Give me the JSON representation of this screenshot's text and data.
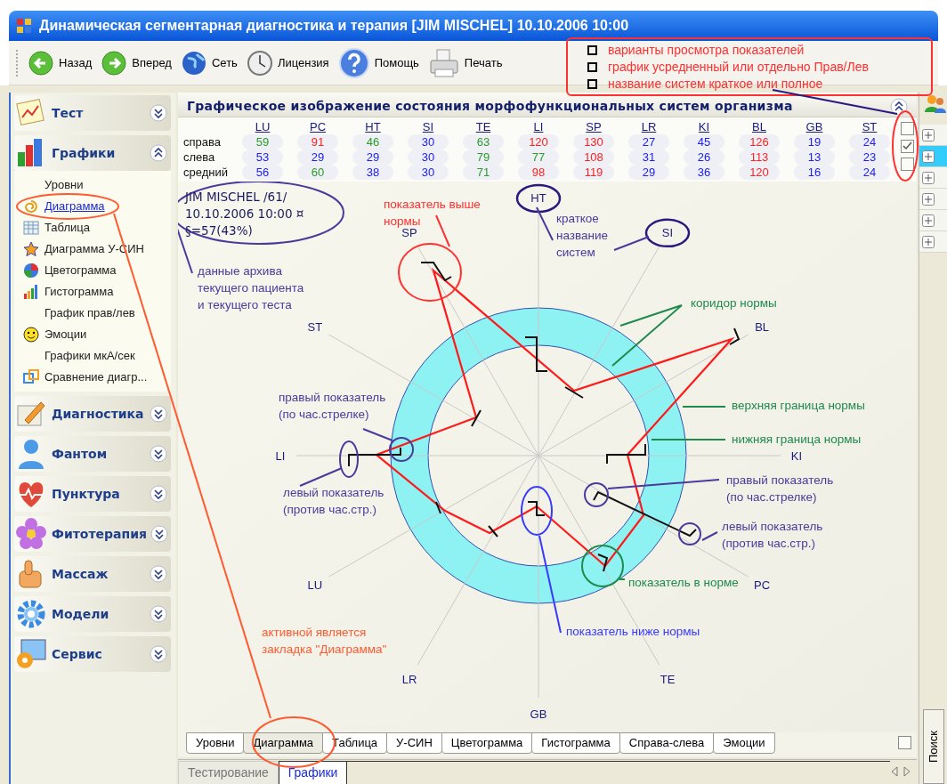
{
  "window": {
    "title": "Динамическая сегментарная диагностика и терапия [JIM MISCHEL] 10.10.2006 10:00"
  },
  "toolbar": [
    {
      "label": "Назад",
      "kind": "back"
    },
    {
      "label": "Вперед",
      "kind": "forward"
    },
    {
      "label": "Сеть",
      "kind": "globe"
    },
    {
      "label": "Лицензия",
      "kind": "clock"
    },
    {
      "label": "Помощь",
      "kind": "help"
    },
    {
      "label": "Печать",
      "kind": "printer"
    }
  ],
  "legend": [
    "варианты просмотра показателей",
    "график усредненный или отдельно Прав/Лев",
    "название систем краткое или полное"
  ],
  "sidebar": [
    {
      "label": "Тест",
      "kind": "test",
      "expanded": false
    },
    {
      "label": "Графики",
      "kind": "charts",
      "expanded": true,
      "items": [
        {
          "label": "Уровни",
          "selected": false
        },
        {
          "label": "Диаграмма",
          "selected": true
        },
        {
          "label": "Таблица",
          "selected": false
        },
        {
          "label": "Диаграмма У-СИН",
          "selected": false
        },
        {
          "label": "Цветограмма",
          "selected": false
        },
        {
          "label": "Гистограмма",
          "selected": false
        },
        {
          "label": "График прав/лев",
          "selected": false
        },
        {
          "label": "Эмоции",
          "selected": false
        },
        {
          "label": "Графики мкА/сек",
          "selected": false
        },
        {
          "label": "Сравнение диагр...",
          "selected": false
        }
      ]
    },
    {
      "label": "Диагностика",
      "kind": "diagnostics",
      "expanded": false
    },
    {
      "label": "Фантом",
      "kind": "phantom",
      "expanded": false
    },
    {
      "label": "Пунктура",
      "kind": "punctura",
      "expanded": false
    },
    {
      "label": "Фитотерапия",
      "kind": "phyto",
      "expanded": false
    },
    {
      "label": "Массаж",
      "kind": "massage",
      "expanded": false
    },
    {
      "label": "Модели",
      "kind": "models",
      "expanded": false
    },
    {
      "label": "Сервис",
      "kind": "service",
      "expanded": false
    }
  ],
  "panel": {
    "title": "Графическое изображение состояния морфофункциональных систем организма"
  },
  "table": {
    "columns": [
      "LU",
      "PC",
      "HT",
      "SI",
      "TE",
      "LI",
      "SP",
      "LR",
      "KI",
      "BL",
      "GB",
      "ST"
    ],
    "rows": [
      {
        "label": "справа",
        "cells": [
          {
            "value": "59",
            "color": "#2a9a2a"
          },
          {
            "value": "91",
            "color": "#ff2020"
          },
          {
            "value": "46",
            "color": "#2a9a2a"
          },
          {
            "value": "30",
            "color": "#2020ee"
          },
          {
            "value": "63",
            "color": "#2a9a2a"
          },
          {
            "value": "120",
            "color": "#ff2020"
          },
          {
            "value": "130",
            "color": "#ff2020"
          },
          {
            "value": "27",
            "color": "#2020ee"
          },
          {
            "value": "45",
            "color": "#2020ee"
          },
          {
            "value": "126",
            "color": "#ff2020"
          },
          {
            "value": "19",
            "color": "#2020ee"
          },
          {
            "value": "24",
            "color": "#2020ee"
          }
        ]
      },
      {
        "label": "слева",
        "cells": [
          {
            "value": "53",
            "color": "#2020ee"
          },
          {
            "value": "29",
            "color": "#2020ee"
          },
          {
            "value": "29",
            "color": "#2020ee"
          },
          {
            "value": "30",
            "color": "#2020ee"
          },
          {
            "value": "79",
            "color": "#2a9a2a"
          },
          {
            "value": "77",
            "color": "#2a9a2a"
          },
          {
            "value": "108",
            "color": "#ff2020"
          },
          {
            "value": "31",
            "color": "#2020ee"
          },
          {
            "value": "26",
            "color": "#2020ee"
          },
          {
            "value": "113",
            "color": "#ff2020"
          },
          {
            "value": "13",
            "color": "#2020ee"
          },
          {
            "value": "23",
            "color": "#2020ee"
          }
        ]
      },
      {
        "label": "средний",
        "cells": [
          {
            "value": "56",
            "color": "#2020ee"
          },
          {
            "value": "60",
            "color": "#2a9a2a"
          },
          {
            "value": "38",
            "color": "#2020ee"
          },
          {
            "value": "30",
            "color": "#2020ee"
          },
          {
            "value": "71",
            "color": "#2a9a2a"
          },
          {
            "value": "98",
            "color": "#ff2020"
          },
          {
            "value": "119",
            "color": "#ff2020"
          },
          {
            "value": "29",
            "color": "#2020ee"
          },
          {
            "value": "36",
            "color": "#2020ee"
          },
          {
            "value": "120",
            "color": "#ff2020"
          },
          {
            "value": "16",
            "color": "#2020ee"
          },
          {
            "value": "24",
            "color": "#2020ee"
          }
        ]
      }
    ]
  },
  "view_options": [
    {
      "checked": false
    },
    {
      "checked": true
    },
    {
      "checked": false
    }
  ],
  "patient_info": [
    "JIM MISCHEL /61/",
    "10.10.2006 10:00 ¤",
    "§=57(43%)"
  ],
  "axes": [
    {
      "label": "HT",
      "circled": true
    },
    {
      "label": "SI",
      "circled": true
    },
    {
      "label": "BL",
      "circled": false
    },
    {
      "label": "KI",
      "circled": false
    },
    {
      "label": "PC",
      "circled": false
    },
    {
      "label": "TE",
      "circled": false
    },
    {
      "label": "GB",
      "circled": false
    },
    {
      "label": "LR",
      "circled": false
    },
    {
      "label": "LU",
      "circled": false
    },
    {
      "label": "LI",
      "circled": false
    },
    {
      "label": "ST",
      "circled": false
    },
    {
      "label": "SP",
      "circled": false
    }
  ],
  "annotations": [
    {
      "kind": "above",
      "lines": [
        "показатель выше",
        "нормы"
      ],
      "color": "#ff3030"
    },
    {
      "kind": "short_name",
      "lines": [
        "краткое",
        "название",
        "систем"
      ],
      "color": "#4a3a9c"
    },
    {
      "kind": "archive",
      "lines": [
        "данные архива",
        "текущего пациента",
        "и текущего теста"
      ],
      "color": "#4a3a9c"
    },
    {
      "kind": "corridor",
      "lines": [
        "коридор нормы"
      ],
      "color": "#1f8a4c"
    },
    {
      "kind": "right_left",
      "lines": [
        "правый показатель",
        "(по час.стрелке)"
      ],
      "color": "#4a3a9c"
    },
    {
      "kind": "upper",
      "lines": [
        "верхняя граница нормы"
      ],
      "color": "#1f8a4c"
    },
    {
      "kind": "lower",
      "lines": [
        "нижняя граница нормы"
      ],
      "color": "#1f8a4c"
    },
    {
      "kind": "right_right",
      "lines": [
        "правый показатель",
        "(по час.стрелке)"
      ],
      "color": "#4a3a9c"
    },
    {
      "kind": "left_left",
      "lines": [
        "левый показатель",
        "(против час.стр.)"
      ],
      "color": "#4a3a9c"
    },
    {
      "kind": "left_right",
      "lines": [
        "левый показатель",
        "(против час.стр.)"
      ],
      "color": "#4a3a9c"
    },
    {
      "kind": "normal",
      "lines": [
        "показатель в норме"
      ],
      "color": "#1f8a4c"
    },
    {
      "kind": "active_tab",
      "lines": [
        "активной является",
        "закладка \"Диаграмма\""
      ],
      "color": "#ff5a30"
    },
    {
      "kind": "below",
      "lines": [
        "показатель ниже нормы"
      ],
      "color": "#3a3aff"
    }
  ],
  "chart_tabs": [
    {
      "label": "Уровни",
      "selected": false
    },
    {
      "label": "Диаграмма",
      "selected": true
    },
    {
      "label": "Таблица",
      "selected": false
    },
    {
      "label": "У-СИН",
      "selected": false
    },
    {
      "label": "Цветограмма",
      "selected": false
    },
    {
      "label": "Гистограмма",
      "selected": false
    },
    {
      "label": "Справа-слева",
      "selected": false
    },
    {
      "label": "Эмоции",
      "selected": false
    }
  ],
  "extra_option": {
    "checked": false
  },
  "bottom_tabs": [
    {
      "label": "Тестирование",
      "selected": false
    },
    {
      "label": "Графики",
      "selected": true
    }
  ],
  "right_tree": [
    {
      "selected": false
    },
    {
      "selected": true
    },
    {
      "selected": false
    },
    {
      "selected": false
    },
    {
      "selected": false
    },
    {
      "selected": false
    }
  ],
  "side_tab": {
    "label": "Поиск"
  }
}
